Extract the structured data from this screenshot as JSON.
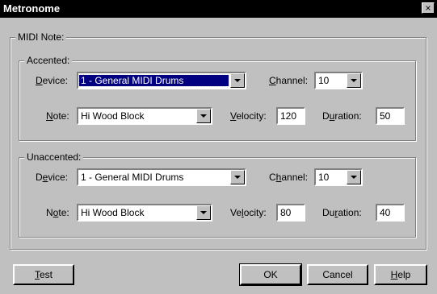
{
  "window": {
    "title": "Metronome",
    "close_glyph": "×"
  },
  "midi_note": {
    "label": "MIDI Note:",
    "accented": {
      "label": "Accented:",
      "device_label": "Device:",
      "device_value": "1 - General MIDI Drums",
      "channel_label": "Channel:",
      "channel_value": "10",
      "note_label": "Note:",
      "note_value": "Hi Wood Block",
      "velocity_label": "Velocity:",
      "velocity_value": "120",
      "duration_label": "Duration:",
      "duration_value": "50"
    },
    "unaccented": {
      "label": "Unaccented:",
      "device_label": "Device:",
      "device_value": "1 - General MIDI Drums",
      "channel_label": "Channel:",
      "channel_value": "10",
      "note_label": "Note:",
      "note_value": "Hi Wood Block",
      "velocity_label": "Velocity:",
      "velocity_value": "80",
      "duration_label": "Duration:",
      "duration_value": "40"
    }
  },
  "buttons": {
    "test": "Test",
    "ok": "OK",
    "cancel": "Cancel",
    "help": "Help"
  }
}
